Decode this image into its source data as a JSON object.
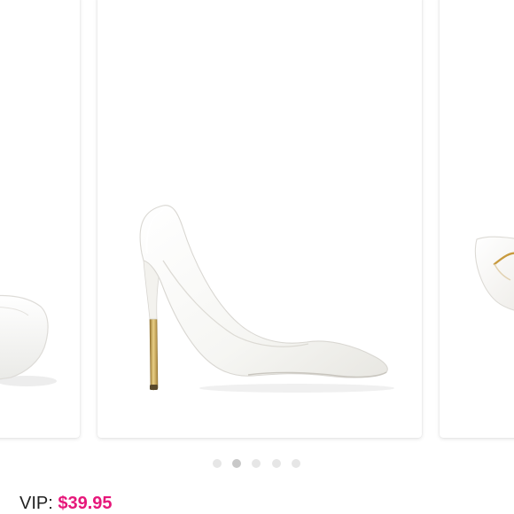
{
  "carousel": {
    "slide_count": 5,
    "active_index": 1,
    "images": [
      {
        "icon": "white-pump-shoe-front-view"
      },
      {
        "icon": "white-pump-shoe-side-view"
      },
      {
        "icon": "white-pump-shoe-back-view"
      }
    ]
  },
  "pricing": {
    "label": "VIP: ",
    "value": "$39.95"
  },
  "colors": {
    "accent": "#e6177a",
    "dot_inactive": "#e6e6e6",
    "dot_active": "#c8c8c8",
    "shoe_white": "#f7f7f5",
    "heel_gold": "#c9a24a"
  }
}
